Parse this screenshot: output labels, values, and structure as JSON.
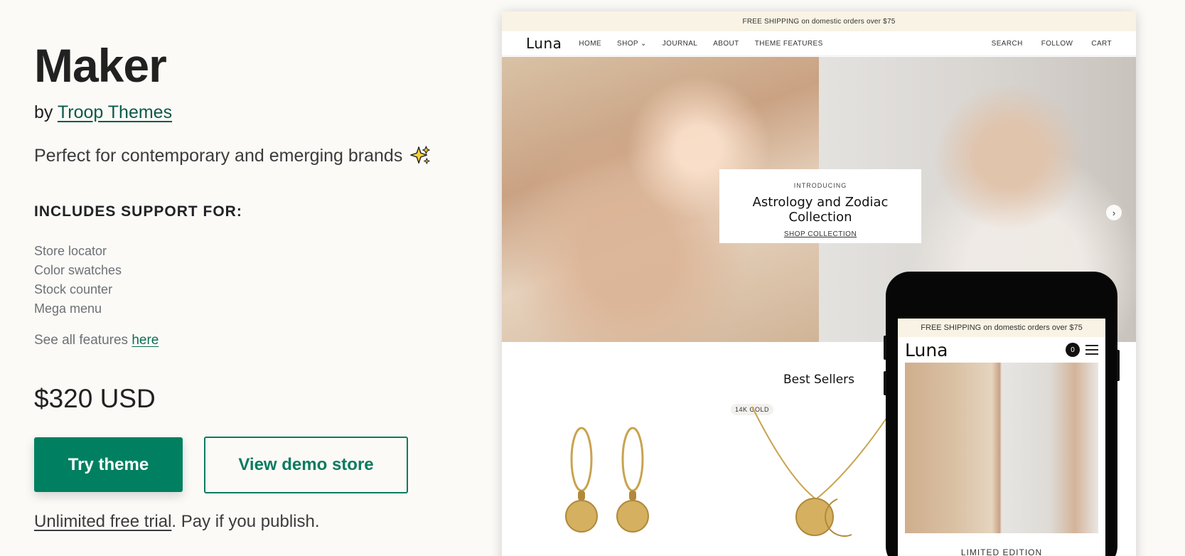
{
  "theme": {
    "name": "Maker",
    "by_prefix": "by",
    "author": "Troop Themes",
    "tagline": "Perfect for contemporary and emerging brands",
    "support_heading": "INCLUDES SUPPORT FOR:",
    "features": [
      "Store locator",
      "Color swatches",
      "Stock counter",
      "Mega menu"
    ],
    "see_all_prefix": "See all features",
    "see_all_link": "here",
    "price": "$320 USD",
    "try_button": "Try theme",
    "demo_button": "View demo store",
    "trial_link": "Unlimited free trial",
    "trial_suffix": ". Pay if you publish.",
    "accent_color": "#008060"
  },
  "desktop_preview": {
    "announcement": "FREE SHIPPING on domestic orders over $75",
    "logo": "Luna",
    "nav_left": [
      "HOME",
      "SHOP",
      "JOURNAL",
      "ABOUT",
      "THEME FEATURES"
    ],
    "nav_right": [
      "SEARCH",
      "FOLLOW",
      "CART"
    ],
    "hero_kicker": "INTRODUCING",
    "hero_title": "Astrology and Zodiac Collection",
    "hero_link": "SHOP COLLECTION",
    "section_title": "Best Sellers",
    "product_badge": "14K GOLD"
  },
  "mobile_preview": {
    "announcement": "FREE SHIPPING on domestic orders over $75",
    "logo": "Luna",
    "cart_count": "0",
    "label": "LIMITED EDITION"
  },
  "icons": [
    "sparkles-icon",
    "chevron-down-icon",
    "chevron-right-icon",
    "hamburger-menu-icon"
  ]
}
